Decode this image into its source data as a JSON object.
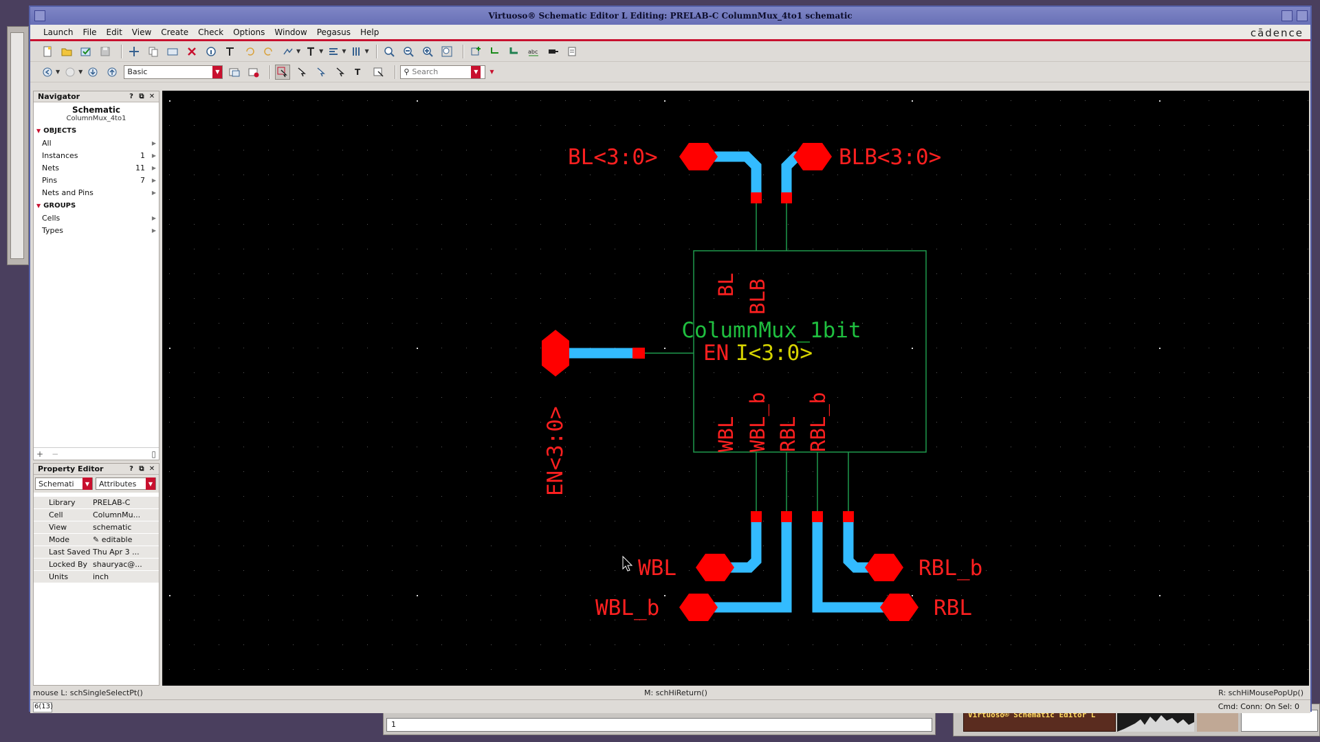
{
  "window": {
    "title": "Virtuoso® Schematic Editor L Editing: PRELAB-C ColumnMux_4to1 schematic",
    "brand": "cādence"
  },
  "menu": [
    "Launch",
    "File",
    "Edit",
    "View",
    "Create",
    "Check",
    "Options",
    "Window",
    "Pegasus",
    "Help"
  ],
  "toolbar2": {
    "workspace": "Basic",
    "search_placeholder": "Search"
  },
  "navigator": {
    "header": "Navigator",
    "title": "Schematic",
    "subtitle": "ColumnMux_4to1",
    "objects_label": "OBJECTS",
    "objects": [
      {
        "label": "All",
        "count": ""
      },
      {
        "label": "Instances",
        "count": "1"
      },
      {
        "label": "Nets",
        "count": "11"
      },
      {
        "label": "Pins",
        "count": "7"
      },
      {
        "label": "Nets and Pins",
        "count": ""
      }
    ],
    "groups_label": "GROUPS",
    "groups": [
      {
        "label": "Cells"
      },
      {
        "label": "Types"
      }
    ],
    "footer_add": "+",
    "footer_remove": "−"
  },
  "property_editor": {
    "header": "Property Editor",
    "type_combo": "Schemati",
    "mode_combo": "Attributes",
    "rows": [
      {
        "key": "Library",
        "value": "PRELAB-C"
      },
      {
        "key": "Cell",
        "value": "ColumnMu..."
      },
      {
        "key": "View",
        "value": "schematic"
      },
      {
        "key": "Mode",
        "value": "editable"
      },
      {
        "key": "Last Saved",
        "value": "Thu Apr  3 ..."
      },
      {
        "key": "Locked By",
        "value": "shauryac@..."
      },
      {
        "key": "Units",
        "value": "inch"
      }
    ]
  },
  "schematic": {
    "instance": {
      "cell": "ColumnMux_1bit",
      "inst_name": "I<3:0>",
      "pins": {
        "top": [
          "BL",
          "BLB"
        ],
        "left": "EN",
        "bottom": [
          "WBL",
          "WBL_b",
          "RBL",
          "RBL_b"
        ]
      }
    },
    "pins": [
      "BL<3:0>",
      "BLB<3:0>",
      "EN<3:0>",
      "WBL",
      "WBL_b",
      "RBL_b",
      "RBL"
    ]
  },
  "status": {
    "mouse_left": "mouse L: schSingleSelectPt()",
    "mouse_middle": "M: schHiReturn()",
    "mouse_right": "R: schHiMousePopUp()",
    "cmd_count": "6(13)",
    "cmd_right": "Cmd:  Conn: On  Sel: 0"
  },
  "background_cli": {
    "mouse_left": "mouse L: schSingleSelectPt()",
    "mouse_middle": "M: schHiReturn()",
    "mouse_right": "R: schHiMousePopUp()",
    "input": "1"
  },
  "taskbar": {
    "task_label": "Virtuoso® Schematic Editor L"
  },
  "colors": {
    "pin": "#ff0000",
    "wire": "#33bbff",
    "net": "#1f9a4e",
    "instance_text": "#1fbf3f",
    "instance_name": "#d6d400",
    "accent": "#c8102e"
  }
}
